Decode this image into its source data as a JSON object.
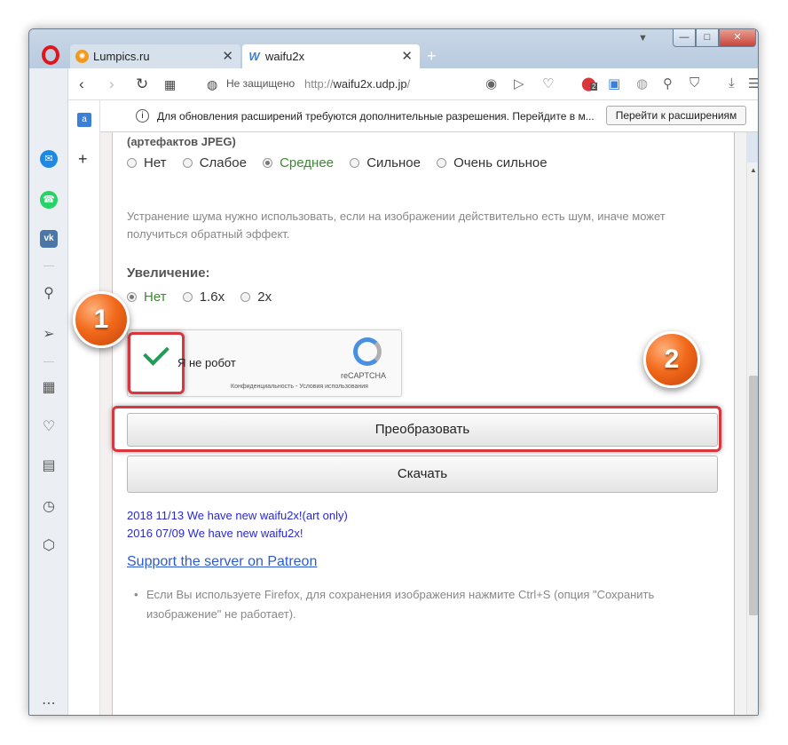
{
  "browser": {
    "tabs": [
      {
        "label": "Lumpics.ru",
        "icon": "orange-slice-icon"
      },
      {
        "label": "waifu2x",
        "icon": "waifu-w-icon"
      }
    ],
    "new_tab_glyph": "+",
    "window_controls": {
      "minimize": "—",
      "maximize": "□",
      "close": "✕"
    }
  },
  "address": {
    "security_label": "Не защищено",
    "url_prefix": "http://",
    "url_host": "waifu2x.udp.jp",
    "url_suffix": "/",
    "extension_badge": "2"
  },
  "infobar": {
    "text": "Для обновления расширений требуются дополнительные разрешения. Перейдите в м...",
    "button_label": "Перейти к расширениям",
    "close_glyph": "✕",
    "info_glyph": "i"
  },
  "noise": {
    "heading": "(артефактов JPEG)",
    "options": [
      {
        "label": "Нет",
        "selected": false
      },
      {
        "label": "Слабое",
        "selected": false
      },
      {
        "label": "Среднее",
        "selected": true
      },
      {
        "label": "Сильное",
        "selected": false
      },
      {
        "label": "Очень сильное",
        "selected": false
      }
    ],
    "hint": "Устранение шума нужно использовать, если на изображении действительно есть шум, иначе может получиться обратный эффект."
  },
  "zoom": {
    "heading": "Увеличение:",
    "options": [
      {
        "label": "Нет",
        "selected": true
      },
      {
        "label": "1.6x",
        "selected": false
      },
      {
        "label": "2x",
        "selected": false
      }
    ]
  },
  "captcha": {
    "label": "Я не робот",
    "brand": "reCAPTCHA",
    "links": "Конфиденциальность - Условия использования",
    "checked": true
  },
  "buttons": {
    "convert": "Преобразовать",
    "download": "Скачать"
  },
  "news": [
    "2018 11/13 We have new waifu2x!(art only)",
    "2016 07/09 We have new waifu2x!"
  ],
  "patreon_link": "Support the server on Patreon",
  "note": "Если Вы используете Firefox, для сохранения изображения нажмите Ctrl+S (опция \"Сохранить изображение\" не работает).",
  "annotations": {
    "badge_1": "1",
    "badge_2": "2",
    "highlight_color": "#d9363e",
    "badge_color": "#f26a1b"
  }
}
